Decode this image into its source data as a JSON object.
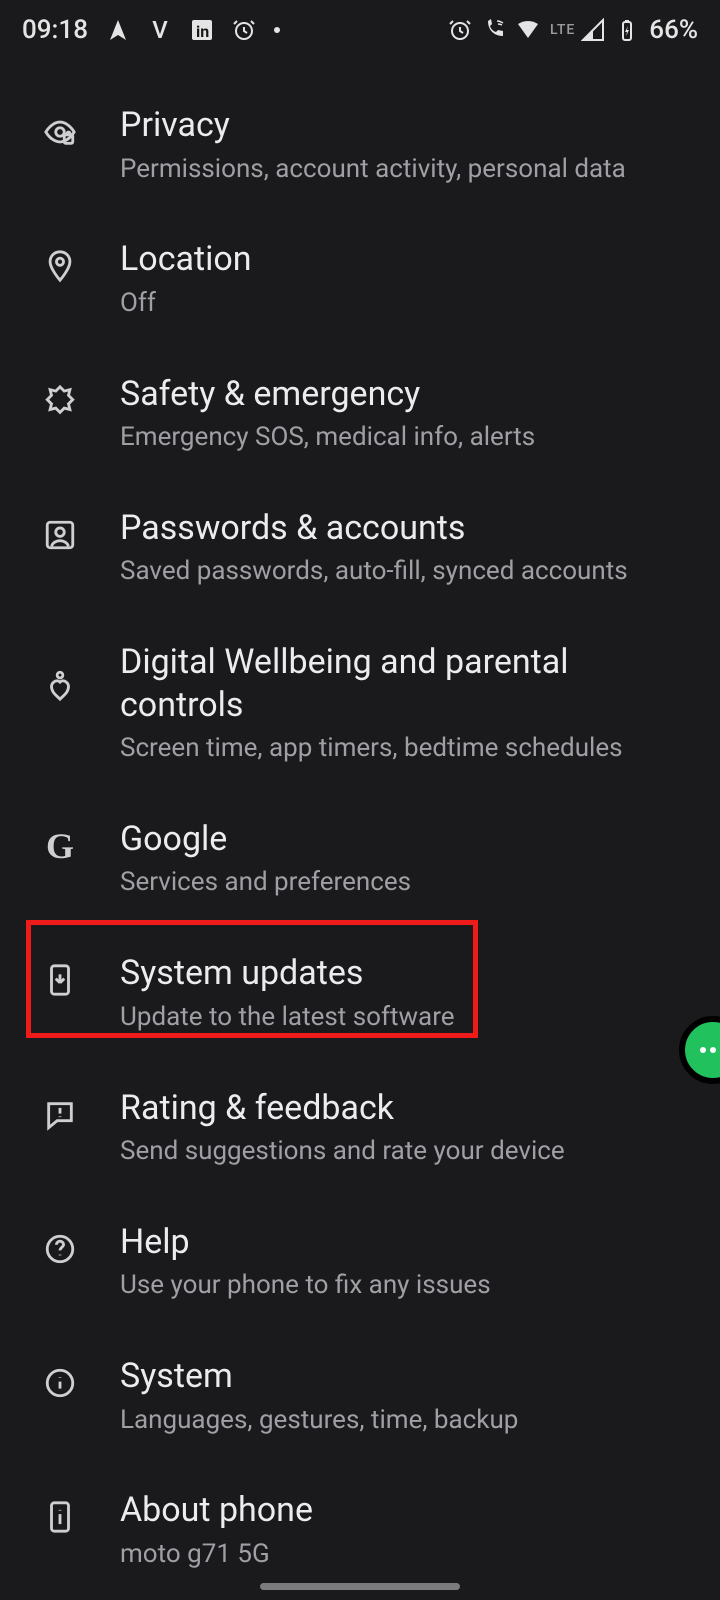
{
  "status": {
    "time": "09:18",
    "battery": "66%",
    "network": "LTE"
  },
  "settings": [
    {
      "title": "Privacy",
      "subtitle": "Permissions, account activity, personal data"
    },
    {
      "title": "Location",
      "subtitle": "Off"
    },
    {
      "title": "Safety & emergency",
      "subtitle": "Emergency SOS, medical info, alerts"
    },
    {
      "title": "Passwords & accounts",
      "subtitle": "Saved passwords, auto-fill, synced accounts"
    },
    {
      "title": "Digital Wellbeing and parental controls",
      "subtitle": "Screen time, app timers, bedtime schedules"
    },
    {
      "title": "Google",
      "subtitle": "Services and preferences"
    },
    {
      "title": "System updates",
      "subtitle": "Update to the latest software"
    },
    {
      "title": "Rating & feedback",
      "subtitle": "Send suggestions and rate your device"
    },
    {
      "title": "Help",
      "subtitle": "Use your phone to fix any issues"
    },
    {
      "title": "System",
      "subtitle": "Languages, gestures, time, backup"
    },
    {
      "title": "About phone",
      "subtitle": "moto g71 5G"
    }
  ],
  "highlighted_item_index": 6
}
